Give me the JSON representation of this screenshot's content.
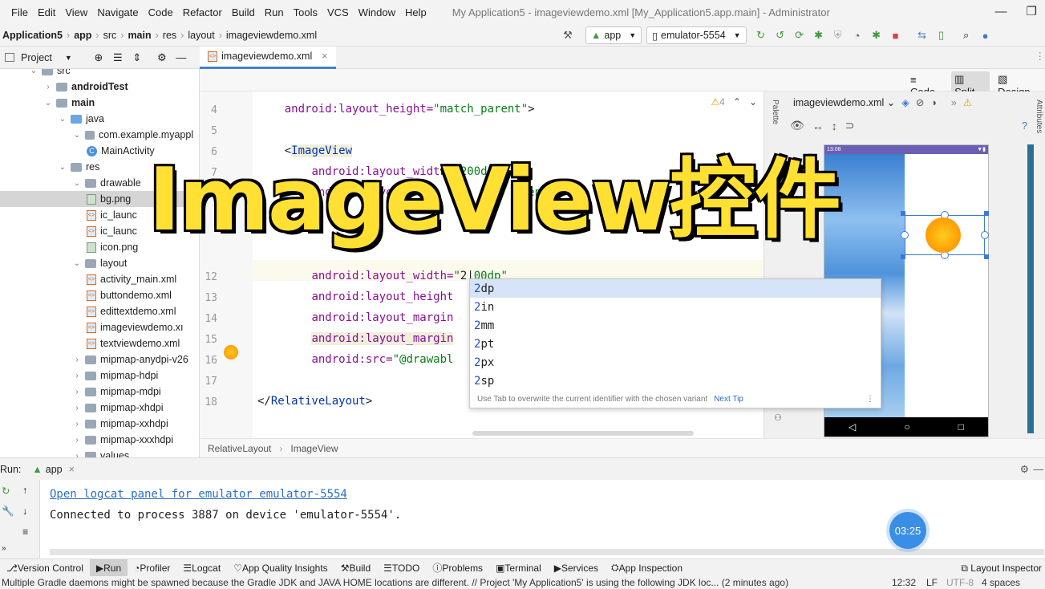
{
  "menu": [
    "File",
    "Edit",
    "View",
    "Navigate",
    "Code",
    "Refactor",
    "Build",
    "Run",
    "Tools",
    "VCS",
    "Window",
    "Help"
  ],
  "window_title": "My Application5 - imageviewdemo.xml [My_Application5.app.main] - Administrator",
  "breadcrumb": [
    "Application5",
    "app",
    "src",
    "main",
    "res",
    "layout",
    "imageviewdemo.xml"
  ],
  "toolbar": {
    "run_config": "app",
    "device": "emulator-5554"
  },
  "project_panel": {
    "label": "Project"
  },
  "tree": [
    {
      "label": "src",
      "depth": 2,
      "kind": "folder",
      "open": true
    },
    {
      "label": "androidTest",
      "depth": 3,
      "kind": "folder",
      "bold": true
    },
    {
      "label": "main",
      "depth": 3,
      "kind": "folder",
      "bold": true,
      "open": true
    },
    {
      "label": "java",
      "depth": 4,
      "kind": "folder-blue",
      "open": true
    },
    {
      "label": "com.example.myappl",
      "depth": 5,
      "kind": "package",
      "open": true
    },
    {
      "label": "MainActivity",
      "depth": 6,
      "kind": "class"
    },
    {
      "label": "res",
      "depth": 4,
      "kind": "folder",
      "open": true
    },
    {
      "label": "drawable",
      "depth": 5,
      "kind": "folder",
      "open": true
    },
    {
      "label": "bg.png",
      "depth": 6,
      "kind": "image",
      "selected": true
    },
    {
      "label": "ic_launc",
      "depth": 6,
      "kind": "xml"
    },
    {
      "label": "ic_launc",
      "depth": 6,
      "kind": "xml"
    },
    {
      "label": "icon.png",
      "depth": 6,
      "kind": "image"
    },
    {
      "label": "layout",
      "depth": 5,
      "kind": "folder",
      "open": true
    },
    {
      "label": "activity_main.xml",
      "depth": 6,
      "kind": "xml"
    },
    {
      "label": "buttondemo.xml",
      "depth": 6,
      "kind": "xml"
    },
    {
      "label": "edittextdemo.xml",
      "depth": 6,
      "kind": "xml"
    },
    {
      "label": "imageviewdemo.xı",
      "depth": 6,
      "kind": "xml"
    },
    {
      "label": "textviewdemo.xml",
      "depth": 6,
      "kind": "xml"
    },
    {
      "label": "mipmap-anydpi-v26",
      "depth": 5,
      "kind": "folder"
    },
    {
      "label": "mipmap-hdpi",
      "depth": 5,
      "kind": "folder"
    },
    {
      "label": "mipmap-mdpi",
      "depth": 5,
      "kind": "folder"
    },
    {
      "label": "mipmap-xhdpi",
      "depth": 5,
      "kind": "folder"
    },
    {
      "label": "mipmap-xxhdpi",
      "depth": 5,
      "kind": "folder"
    },
    {
      "label": "mipmap-xxxhdpi",
      "depth": 5,
      "kind": "folder"
    },
    {
      "label": "values",
      "depth": 5,
      "kind": "folder"
    }
  ],
  "editor_tab": "imageviewdemo.xml",
  "view_modes": [
    "Code",
    "Split",
    "Design"
  ],
  "warning_count": "4",
  "code_lines": [
    {
      "n": "4",
      "parts": [
        {
          "t": "    "
        },
        {
          "t": "android:layout_height=",
          "c": "attr"
        },
        {
          "t": "\"match_parent\"",
          "c": "val"
        },
        {
          "t": ">"
        }
      ]
    },
    {
      "n": "5",
      "parts": []
    },
    {
      "n": "6",
      "parts": [
        {
          "t": "    <"
        },
        {
          "t": "ImageView",
          "c": "tag hl"
        }
      ]
    },
    {
      "n": "7",
      "parts": [
        {
          "t": "        "
        },
        {
          "t": "android:layout_width=",
          "c": "attr"
        },
        {
          "t": "\"200dp\"",
          "c": "val"
        }
      ]
    },
    {
      "n": "8",
      "parts": [
        {
          "t": "        "
        },
        {
          "t": "android:layout_he",
          "c": "attr"
        },
        {
          "t": "               "
        },
        {
          "t": "ent\"",
          "c": "val"
        }
      ]
    },
    {
      "n": "12",
      "parts": [
        {
          "t": "        "
        },
        {
          "t": "android:layout_width=",
          "c": "attr"
        },
        {
          "t": "\"",
          "c": "val"
        },
        {
          "t": "2|",
          "c": ""
        },
        {
          "t": "00dp\"",
          "c": "val"
        }
      ]
    },
    {
      "n": "13",
      "parts": [
        {
          "t": "        "
        },
        {
          "t": "android:layout_height",
          "c": "attr"
        }
      ]
    },
    {
      "n": "14",
      "parts": [
        {
          "t": "        "
        },
        {
          "t": "android:layout_margin",
          "c": "attr"
        }
      ]
    },
    {
      "n": "15",
      "parts": [
        {
          "t": "        "
        },
        {
          "t": "android:layout_margin",
          "c": "attr hl"
        }
      ]
    },
    {
      "n": "16",
      "parts": [
        {
          "t": "        "
        },
        {
          "t": "android:src=",
          "c": "attr"
        },
        {
          "t": "\"@drawabl",
          "c": "val"
        }
      ]
    },
    {
      "n": "17",
      "parts": []
    },
    {
      "n": "18",
      "parts": [
        {
          "t": "</"
        },
        {
          "t": "RelativeLayout",
          "c": "tag"
        },
        {
          "t": ">"
        }
      ]
    }
  ],
  "completion": {
    "items": [
      {
        "prefix": "2",
        "suffix": "dp"
      },
      {
        "prefix": "2",
        "suffix": "in"
      },
      {
        "prefix": "2",
        "suffix": "mm"
      },
      {
        "prefix": "2",
        "suffix": "pt"
      },
      {
        "prefix": "2",
        "suffix": "px"
      },
      {
        "prefix": "2",
        "suffix": "sp"
      }
    ],
    "hint": "Use Tab to overwrite the current identifier with the chosen variant",
    "next_tip": "Next Tip"
  },
  "editor_breadcrumb": [
    "RelativeLayout",
    "ImageView"
  ],
  "design": {
    "file": "imageviewdemo.xml",
    "palette_label": "Palette",
    "attributes_label": "Attributes",
    "phone_time": "13:08"
  },
  "overlay_title": "ImageView控件",
  "run": {
    "label": "Run:",
    "config": "app",
    "link": "Open logcat panel for emulator emulator-5554",
    "message": "Connected to process 3887 on device 'emulator-5554'."
  },
  "timer": "03:25",
  "tool_windows": [
    "Version Control",
    "Run",
    "Profiler",
    "Logcat",
    "App Quality Insights",
    "Build",
    "TODO",
    "Problems",
    "Terminal",
    "Services",
    "App Inspection"
  ],
  "layout_inspector": "Layout Inspector",
  "status": {
    "message": "Multiple Gradle daemons might be spawned because the Gradle JDK and JAVA HOME locations are different. // Project 'My Application5' is using the following JDK loc... (2 minutes ago)",
    "position": "12:32",
    "line_sep": "LF",
    "encoding": "UTF-8",
    "indent": "4 spaces"
  },
  "colors": {
    "accent": "#4083c9",
    "title_fill": "#ffe033",
    "run_green": "#3c9a3c",
    "stop_red": "#d94040"
  }
}
